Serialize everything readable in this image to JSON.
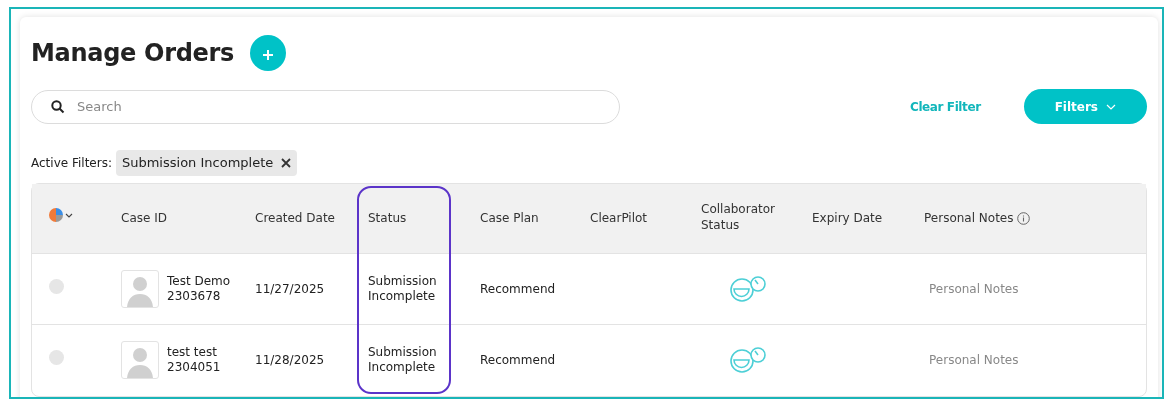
{
  "page": {
    "title": "Manage Orders"
  },
  "search": {
    "placeholder": "Search"
  },
  "clear_filter": "Clear Filter",
  "filters_button": "Filters",
  "active_filters": {
    "label": "Active Filters:",
    "chips": [
      "Submission Incomplete"
    ]
  },
  "table": {
    "columns": [
      {
        "kind": "icon",
        "highlighted": false
      },
      {
        "label": "Case ID",
        "kind": "text",
        "highlighted": false
      },
      {
        "label": "Created Date",
        "kind": "text",
        "highlighted": false
      },
      {
        "label": "Status",
        "kind": "text",
        "highlighted": true
      },
      {
        "label": "Case Plan",
        "kind": "text",
        "highlighted": false
      },
      {
        "label": "ClearPilot",
        "kind": "text",
        "highlighted": false
      },
      {
        "label": "Collaborator Status",
        "kind": "text",
        "highlighted": false
      },
      {
        "label": "Expiry Date",
        "kind": "text",
        "highlighted": false
      },
      {
        "label": "Personal Notes",
        "kind": "info",
        "highlighted": false
      }
    ],
    "rows": [
      {
        "selected": false,
        "name": "Test Demo",
        "case_id": "2303678",
        "created": "11/27/2025",
        "status": "Submission Incomplete",
        "case_plan": "Recommend",
        "notes": "Personal Notes"
      },
      {
        "selected": false,
        "name": "test test",
        "case_id": "2304051",
        "created": "11/28/2025",
        "status": "Submission Incomplete",
        "case_plan": "Recommend",
        "notes": "Personal Notes"
      }
    ]
  }
}
